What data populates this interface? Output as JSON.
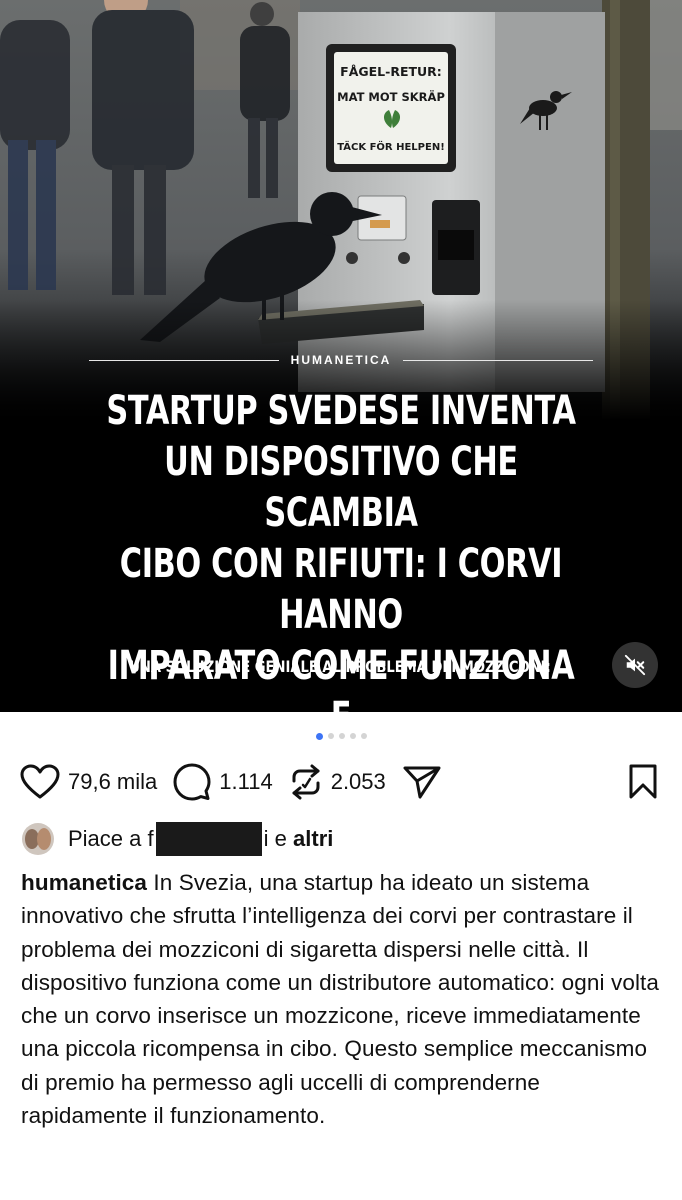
{
  "post": {
    "image_sign": {
      "line1": "FÅGEL-RETUR:",
      "line2": "MAT MOT SKRÄP",
      "line3": "TÄCK FÖR HELPEN!"
    },
    "brand": "HUMANETICA",
    "headline": "STARTUP SVEDESE INVENTA\nUN DISPOSITIVO CHE SCAMBIA\nCIBO CON RIFIUTI: I CORVI HANNO\nIMPARATO COME FUNZIONA E\nADESSO RIPULISCONO LE CITTÀ!",
    "subheadline": "UNA SOLUZIONE GENIALE AL PROBLEMA DEI MOZZICONI:",
    "carousel": {
      "count": 5,
      "active_index": 0
    }
  },
  "actions": {
    "likes": "79,6 mila",
    "comments": "1.114",
    "reposts": "2.053"
  },
  "liked_by": {
    "prefix": "Piace a",
    "name_partial_start": "f",
    "name_partial_end": "i",
    "suffix_and": "e",
    "suffix_others": "altri"
  },
  "caption": {
    "username": "humanetica",
    "text": "In Svezia, una startup ha ideato un sistema innovativo che sfrutta l’intelligenza dei corvi per contrastare il problema dei mozziconi di sigaretta dispersi nelle città. Il dispositivo funziona come un distributore automatico: ogni volta che un corvo inserisce un mozzicone, riceve immediatamente una piccola ricompensa in cibo. Questo semplice meccanismo di premio ha permesso agli uccelli di comprenderne rapidamente il funzionamento."
  },
  "colors": {
    "accent_dot": "#3d74f5",
    "sign_green": "#3f7f3a"
  },
  "icons": [
    "heart-icon",
    "comment-icon",
    "repost-icon",
    "share-icon",
    "bookmark-icon",
    "volume-muted-icon",
    "leaf-icon",
    "crow-icon"
  ]
}
